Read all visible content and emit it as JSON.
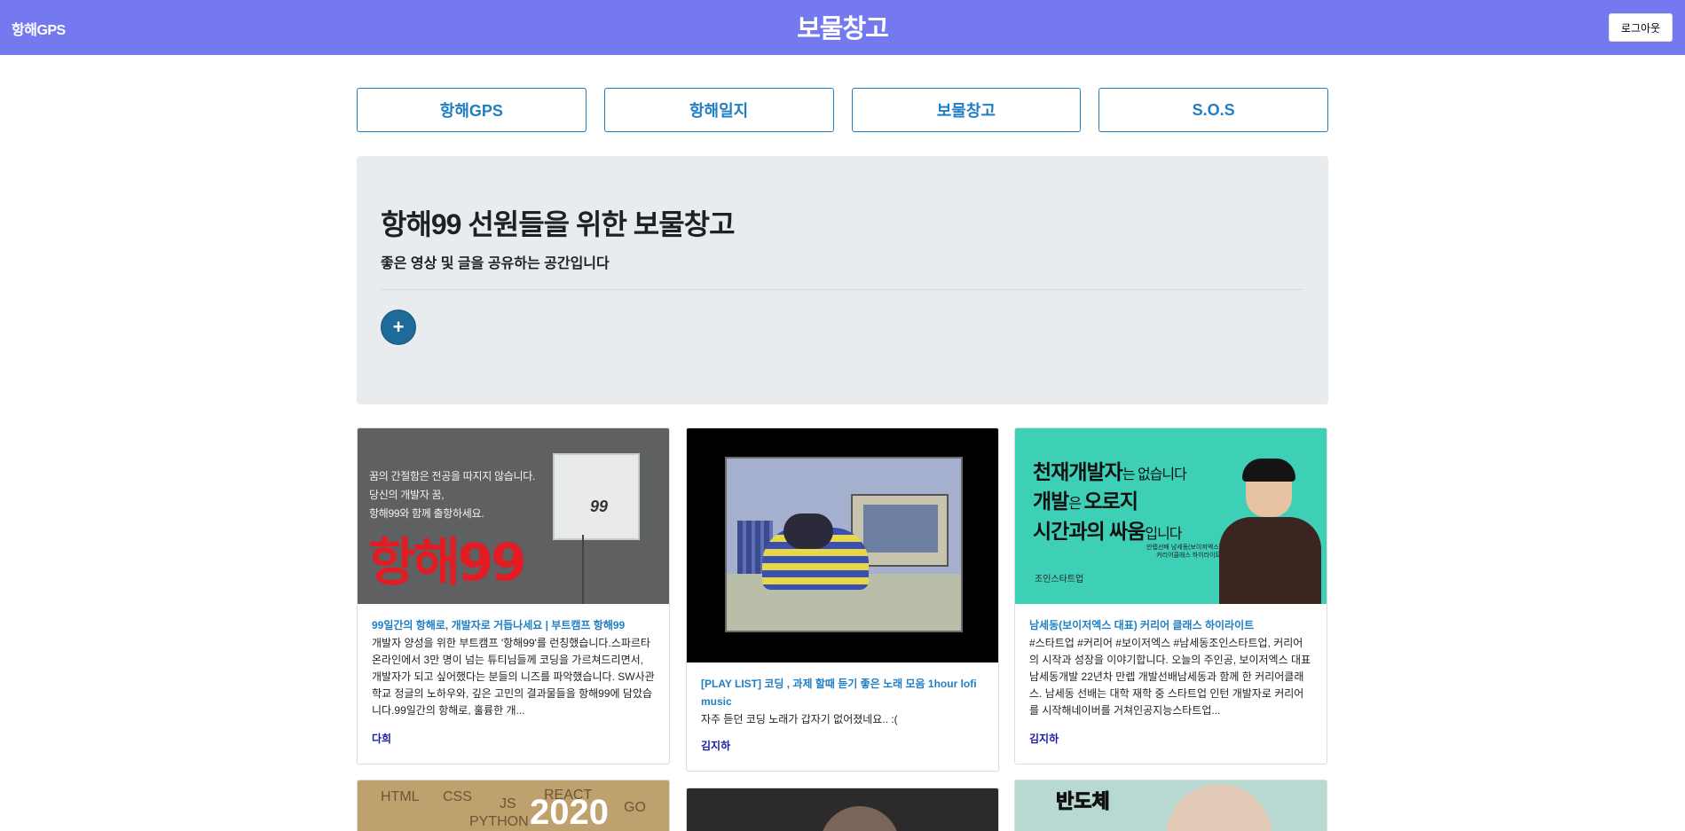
{
  "header": {
    "brand": "항해GPS",
    "title": "보물창고",
    "logout_label": "로그아웃"
  },
  "nav": [
    {
      "label": "항해GPS"
    },
    {
      "label": "항해일지"
    },
    {
      "label": "보물창고"
    },
    {
      "label": "S.O.S"
    }
  ],
  "hero": {
    "title": "항해99 선원들을 위한 보물창고",
    "subtitle": "좋은 영상 및 글을 공유하는 공간입니다",
    "add_label": "+"
  },
  "cards": [
    {
      "title": "99일간의 항해로, 개발자로 거듭나세요 | 부트캠프 항해99",
      "description": "개발자 양성을 위한 부트캠프 '항해99'를 런칭했습니다.스파르타온라인에서 3만 명이 넘는 튜티님들께 코딩을 가르쳐드리면서, 개발자가 되고 싶어했다는 분들의 니즈를 파악했습니다. SW사관학교 정글의 노하우와, 깊은 고민의 결과물들을 항해99에 담았습니다.99일간의 항해로, 훌륭한 개...",
      "author": "다희",
      "thumb": {
        "line1": "꿈의 간절함은 전공을 따지지 않습니다.",
        "line2": "당신의 개발자 꿈,",
        "line3": "항해99와 함께 출항하세요.",
        "big": "항해99",
        "logo": "99"
      }
    },
    {
      "title": "[PLAY LIST] 코딩 , 과제 할때 듣기 좋은 노래 모음 1hour lofi music",
      "description": "자주 듣던 코딩 노래가 갑자기 없어졌네요.. :(",
      "author": "김지하"
    },
    {
      "title": "남세동(보이저엑스 대표) 커리어 클래스 하이라이트",
      "description": "#스타트업 #커리어 #보이저엑스 #남세동조인스타트업, 커리어의 시작과 성장을 이야기합니다. 오늘의 주인공, 보이저엑스 대표 남세동개발 22년차 만렙 개발선배남세동과 함께 한 커리어클래스. 남세동 선배는 대학 재학 중 스타트업 인턴 개발자로 커리어를 시작해네이버를 거쳐인공지능스타트업...",
      "author": "김지하",
      "thumb": {
        "l1_bold": "천재개발자",
        "l1_rest": "는 없습니다",
        "l2_bold_a": "개발",
        "l2_rest_a": "은 ",
        "l2_bold_b": "오로지",
        "l3_bold": "시간과의 싸움",
        "l3_rest": "입니다",
        "small1": "만렙선배 남세동(보이저엑스)",
        "small2": "커리어클래스 하이라이트",
        "corp": "조인스타트업"
      }
    }
  ],
  "partial_cards": {
    "p1_words": [
      "HTML",
      "CSS",
      "JS",
      "REACT",
      "GO",
      "PYTHON"
    ],
    "p1_year": "2020",
    "p3_word": "반도체"
  }
}
